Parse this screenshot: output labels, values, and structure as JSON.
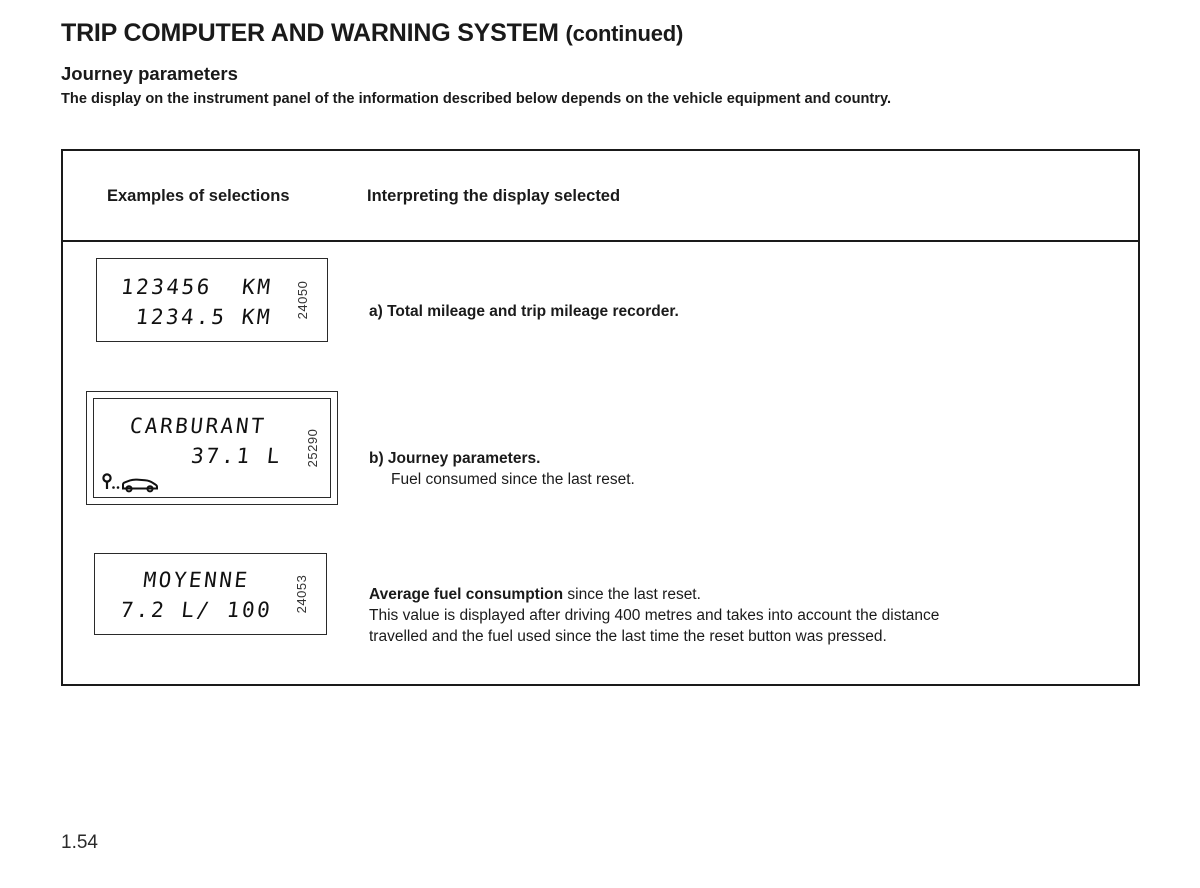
{
  "header": {
    "title": "TRIP COMPUTER AND WARNING SYSTEM",
    "title_suffix": "(continued)",
    "section_title": "Journey parameters",
    "intro": "The display on the instrument panel of the information described below depends on the vehicle equipment and country."
  },
  "table": {
    "columns": {
      "examples": "Examples of selections",
      "interpreting": "Interpreting the display selected"
    },
    "rows": [
      {
        "id": "row-total-mileage",
        "figure": {
          "ref": "24050",
          "lines": [
            "123456  KM",
            "1234.5 KM"
          ],
          "icon": null
        },
        "description": {
          "marker_bold": "a) Total mileage and trip mileage recorder.",
          "body": ""
        }
      },
      {
        "id": "row-journey-parameters",
        "figure": {
          "ref": "25290",
          "lines": [
            "CARBURANT",
            "37.1 L"
          ],
          "icon": "journey-start-car-icon"
        },
        "description": {
          "marker_bold": "b) Journey parameters.",
          "body": "Fuel consumed since the last reset."
        }
      },
      {
        "id": "row-average-consumption",
        "figure": {
          "ref": "24053",
          "lines": [
            "MOYENNE",
            "7.2 L/ 100"
          ],
          "icon": null
        },
        "description": {
          "marker_bold": "Average fuel consumption",
          "body_inline": " since the last reset.",
          "body_line2": "This value is displayed after driving 400 metres and takes into account the distance",
          "body_line3": "travelled and the fuel used since the last time the reset button was pressed."
        }
      }
    ]
  },
  "footer": {
    "page_number": "1.54"
  },
  "colors": {
    "text": "#1a1a1a",
    "border": "#1a1a1a",
    "background": "#ffffff"
  }
}
